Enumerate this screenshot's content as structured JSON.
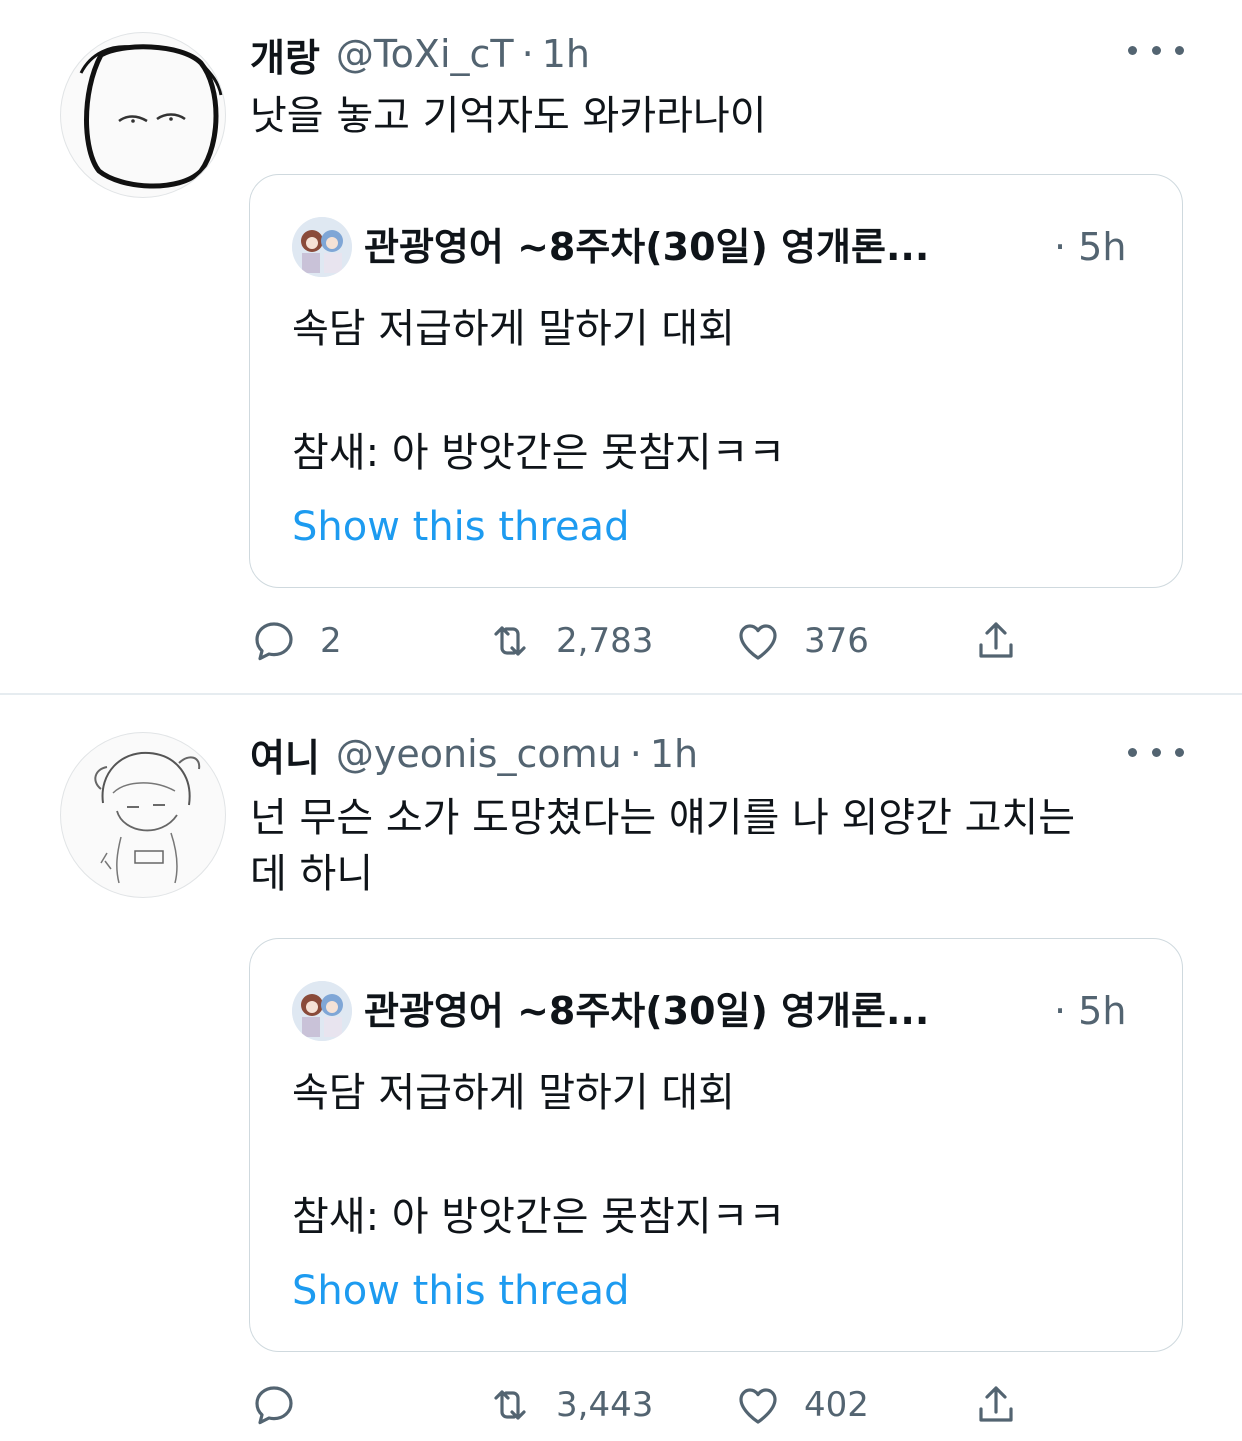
{
  "tweets": [
    {
      "name": "개랑",
      "handle": "@ToXi_cT",
      "dot": "·",
      "time": "1h",
      "text": "낫을 놓고 기억자도 와카라나이",
      "quote": {
        "name": "관광영어 ~8주차(30일) 영개론...",
        "time": "· 5h",
        "line1": "속담 저급하게 말하기 대회",
        "line2": "참새: 아 방앗간은 못참지ㅋㅋ",
        "link": "Show this thread"
      },
      "replies": "2",
      "retweets": "2,783",
      "likes": "376"
    },
    {
      "name": "여니",
      "handle": "@yeonis_comu",
      "dot": "·",
      "time": "1h",
      "text_line1": "넌 무슨 소가 도망쳤다는 얘기를 나 외양간 고치는",
      "text_line2": "데 하니",
      "quote": {
        "name": "관광영어 ~8주차(30일) 영개론...",
        "time": "· 5h",
        "line1": "속담 저급하게 말하기 대회",
        "line2": "참새: 아 방앗간은 못참지ㅋㅋ",
        "link": "Show this thread"
      },
      "replies": "",
      "retweets": "3,443",
      "likes": "402"
    }
  ],
  "colors": {
    "link": "#1d9bf0",
    "secondary": "#536471",
    "border": "#cfd9de"
  }
}
